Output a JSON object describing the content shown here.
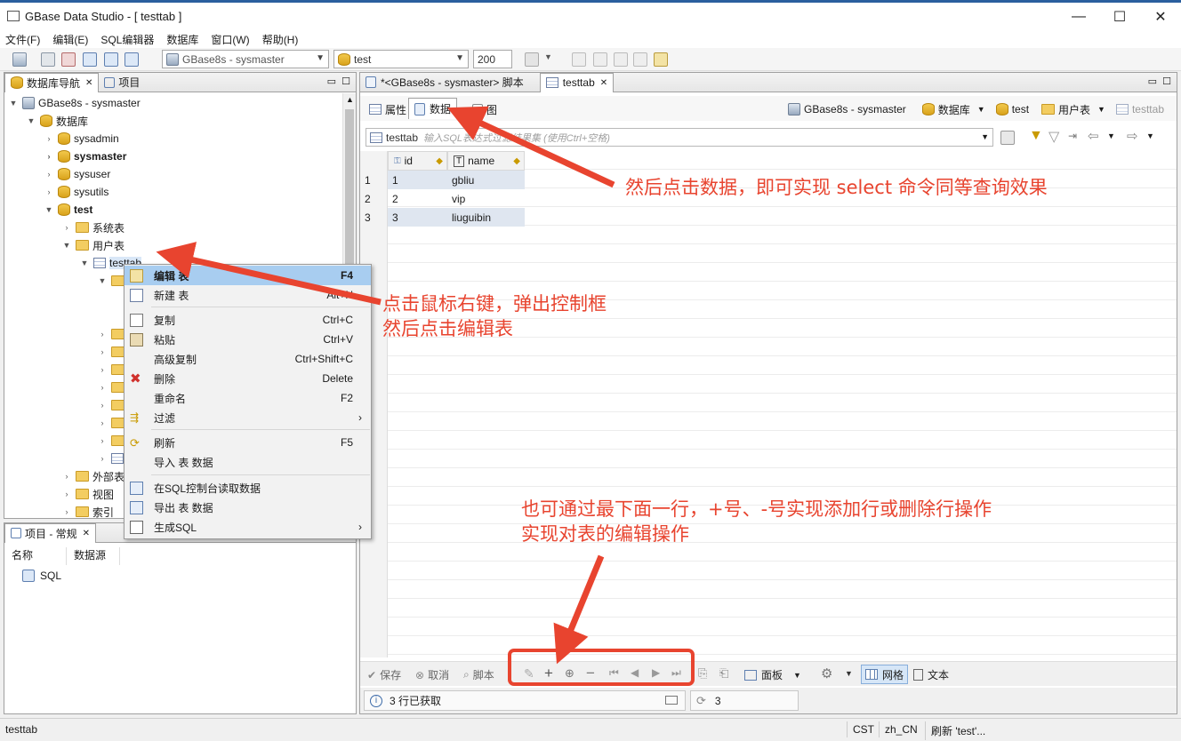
{
  "window": {
    "title": "GBase Data Studio - [ testtab ]",
    "controls": [
      "—",
      "☐",
      "✕"
    ]
  },
  "menubar": [
    "文件(F)",
    "编辑(E)",
    "SQL编辑器",
    "数据库",
    "窗口(W)",
    "帮助(H)"
  ],
  "toolbar": {
    "connection": "GBase8s - sysmaster",
    "database": "test",
    "row_limit": "200"
  },
  "navigator": {
    "tabs": [
      "数据库导航",
      "项目"
    ],
    "tree": {
      "server": "GBase8s - sysmaster",
      "db_folder": "数据库",
      "databases": [
        "sysadmin",
        "sysmaster",
        "sysuser",
        "sysutils",
        "test"
      ],
      "test_children": [
        "系统表",
        "用户表"
      ],
      "table": "testtab",
      "lower_items": [
        "外部表",
        "视图",
        "索引"
      ]
    }
  },
  "project_panel": {
    "tab": "项目 - 常规",
    "columns": [
      "名称",
      "数据源"
    ],
    "item": "SQL"
  },
  "context_menu": {
    "items": [
      {
        "label": "编辑 表",
        "shortcut": "F4"
      },
      {
        "label": "新建 表",
        "shortcut": "Alt+N"
      },
      {
        "label": "复制",
        "shortcut": "Ctrl+C"
      },
      {
        "label": "粘贴",
        "shortcut": "Ctrl+V"
      },
      {
        "label": "高级复制",
        "shortcut": "Ctrl+Shift+C"
      },
      {
        "label": "删除",
        "shortcut": "Delete"
      },
      {
        "label": "重命名",
        "shortcut": "F2"
      },
      {
        "label": "过滤",
        "shortcut": "›"
      },
      {
        "label": "刷新",
        "shortcut": "F5"
      },
      {
        "label": "导入 表 数据",
        "shortcut": ""
      },
      {
        "label": "在SQL控制台读取数据",
        "shortcut": ""
      },
      {
        "label": "导出 表 数据",
        "shortcut": ""
      },
      {
        "label": "生成SQL",
        "shortcut": "›"
      }
    ]
  },
  "editor": {
    "tabs": [
      "*<GBase8s - sysmaster> 脚本",
      "testtab"
    ],
    "subtabs": [
      "属性",
      "数据",
      "图"
    ],
    "breadcrumb": [
      "GBase8s - sysmaster",
      "数据库",
      "test",
      "用户表",
      "testtab"
    ],
    "filter_table": "testtab",
    "filter_placeholder": "输入SQL表达式过滤结果集 (使用Ctrl+空格)",
    "columns": [
      "id",
      "name"
    ],
    "rows": [
      {
        "num": "1",
        "id": "1",
        "name": "gbliu"
      },
      {
        "num": "2",
        "id": "2",
        "name": "vip"
      },
      {
        "num": "3",
        "id": "3",
        "name": "liuguibin"
      }
    ],
    "bottom_toolbar": {
      "save": "保存",
      "cancel": "取消",
      "script": "脚本",
      "panels": "面板",
      "grid": "网格",
      "text": "文本"
    },
    "status_rows": "3 行已获取",
    "status_count": "3"
  },
  "statusbar": {
    "left": "testtab",
    "tz": "CST",
    "locale": "zh_CN",
    "message": "刷新 'test'..."
  },
  "annotations": {
    "a1": "然后点击数据，即可实现 select 命令同等查询效果",
    "a2_line1": "点击鼠标右键，弹出控制框",
    "a2_line2": "然后点击编辑表",
    "a3_line1": "也可通过最下面一行，+号、-号实现添加行或删除行操作",
    "a3_line2": "实现对表的编辑操作"
  },
  "colors": {
    "annotation": "#e8442f",
    "selection": "#a8cdf0",
    "title_border": "#2b5f9e"
  }
}
